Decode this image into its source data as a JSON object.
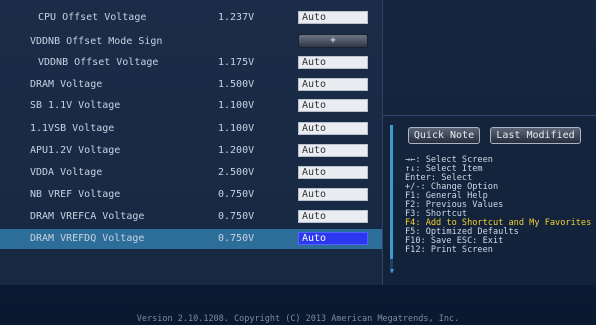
{
  "settings": [
    {
      "label": "CPU Offset Voltage",
      "value": "1.237V",
      "field": "Auto",
      "type": "field",
      "indent": true
    },
    {
      "label": "VDDNB Offset Mode Sign",
      "value": "",
      "field": "+",
      "type": "button",
      "indent": false
    },
    {
      "label": "VDDNB Offset Voltage",
      "value": "1.175V",
      "field": "Auto",
      "type": "field",
      "indent": true
    },
    {
      "label": "DRAM Voltage",
      "value": "1.500V",
      "field": "Auto",
      "type": "field",
      "indent": false
    },
    {
      "label": "SB 1.1V Voltage",
      "value": "1.100V",
      "field": "Auto",
      "type": "field",
      "indent": false
    },
    {
      "label": "1.1VSB Voltage",
      "value": "1.100V",
      "field": "Auto",
      "type": "field",
      "indent": false
    },
    {
      "label": "APU1.2V Voltage",
      "value": "1.200V",
      "field": "Auto",
      "type": "field",
      "indent": false
    },
    {
      "label": "VDDA Voltage",
      "value": "2.500V",
      "field": "Auto",
      "type": "field",
      "indent": false
    },
    {
      "label": "NB VREF Voltage",
      "value": "0.750V",
      "field": "Auto",
      "type": "field",
      "indent": false
    },
    {
      "label": "DRAM VREFCA Voltage",
      "value": "0.750V",
      "field": "Auto",
      "type": "field",
      "indent": false
    },
    {
      "label": "DRAM VREFDQ Voltage",
      "value": "0.750V",
      "field": "Auto",
      "type": "field",
      "indent": false,
      "selected": true
    }
  ],
  "side": {
    "quick_note": "Quick Note",
    "last_modified": "Last Modified"
  },
  "help": [
    {
      "text": "→←: Select Screen"
    },
    {
      "text": "↑↓: Select Item"
    },
    {
      "text": "Enter: Select"
    },
    {
      "text": "+/-: Change Option"
    },
    {
      "text": "F1: General Help"
    },
    {
      "text": "F2: Previous Values"
    },
    {
      "text": "F3: Shortcut"
    },
    {
      "text": "F4: Add to Shortcut and My Favorites",
      "highlight": true
    },
    {
      "text": "F5: Optimized Defaults"
    },
    {
      "text": "F10: Save  ESC: Exit"
    },
    {
      "text": "F12: Print Screen"
    }
  ],
  "footer": "Version 2.10.1208. Copyright (C) 2013 American Megatrends, Inc.",
  "colors": {
    "selected_row": "#2d6d9a",
    "selected_field": "#2b38f0",
    "highlight_text": "#f0d030",
    "scrollbar": "#3e9bd0"
  }
}
